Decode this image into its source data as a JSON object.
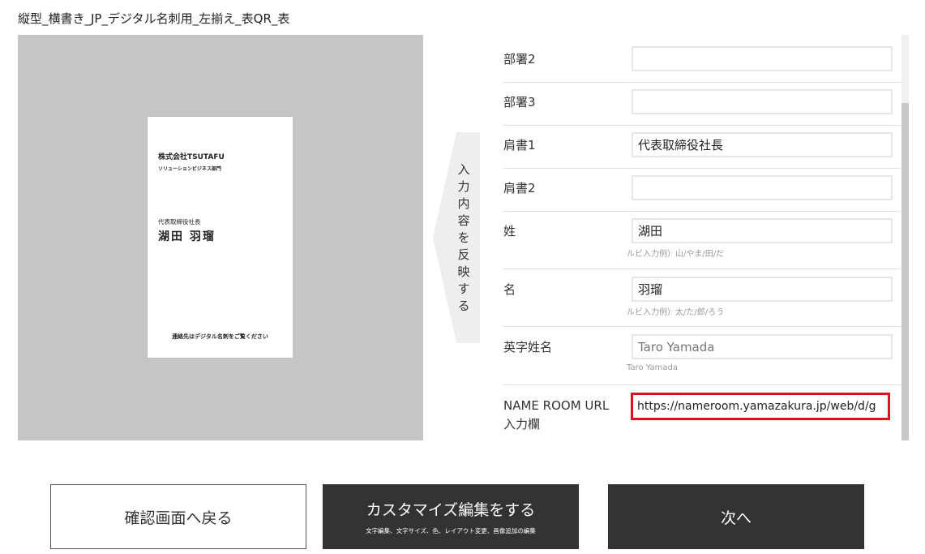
{
  "page": {
    "title": "縦型_横書き_JP_デジタル名刺用_左揃え_表QR_表"
  },
  "card": {
    "company": "株式会社TSUTAFU",
    "department": "ソリューションビジネス部門",
    "position": "代表取締役社長",
    "name": "湖田 羽瑠",
    "footer": "連絡先はデジタル名刺をご覧ください"
  },
  "reflect_tab": {
    "label": "入力内容を反映する"
  },
  "form": {
    "rows": [
      {
        "label": "部署2",
        "value": "",
        "hint": ""
      },
      {
        "label": "部署3",
        "value": "",
        "hint": ""
      },
      {
        "label": "肩書1",
        "value": "代表取締役社長",
        "hint": ""
      },
      {
        "label": "肩書2",
        "value": "",
        "hint": ""
      },
      {
        "label": "姓",
        "value": "湖田",
        "hint": "ルビ入力例）山/やま/田/だ"
      },
      {
        "label": "名",
        "value": "羽瑠",
        "hint": "ルビ入力例）太/た/郎/ろう"
      },
      {
        "label": "英字姓名",
        "value": "",
        "hint": "Taro Yamada"
      },
      {
        "label_line1": "NAME ROOM URL",
        "label_line2": "入力欄",
        "value": "https://nameroom.yamazakura.jp/web/d/g",
        "hint": ""
      }
    ]
  },
  "buttons": {
    "back": "確認画面へ戻る",
    "customize": "カスタマイズ編集をする",
    "customize_sub": "文字編集、文字サイズ、色、レイアウト変更、画像追加の編集",
    "next": "次へ"
  },
  "colors": {
    "preview_bg": "#c5c5c5",
    "dark_button": "#333333",
    "active_input_border": "#e0121d",
    "tab_bg": "#eeeeee"
  }
}
